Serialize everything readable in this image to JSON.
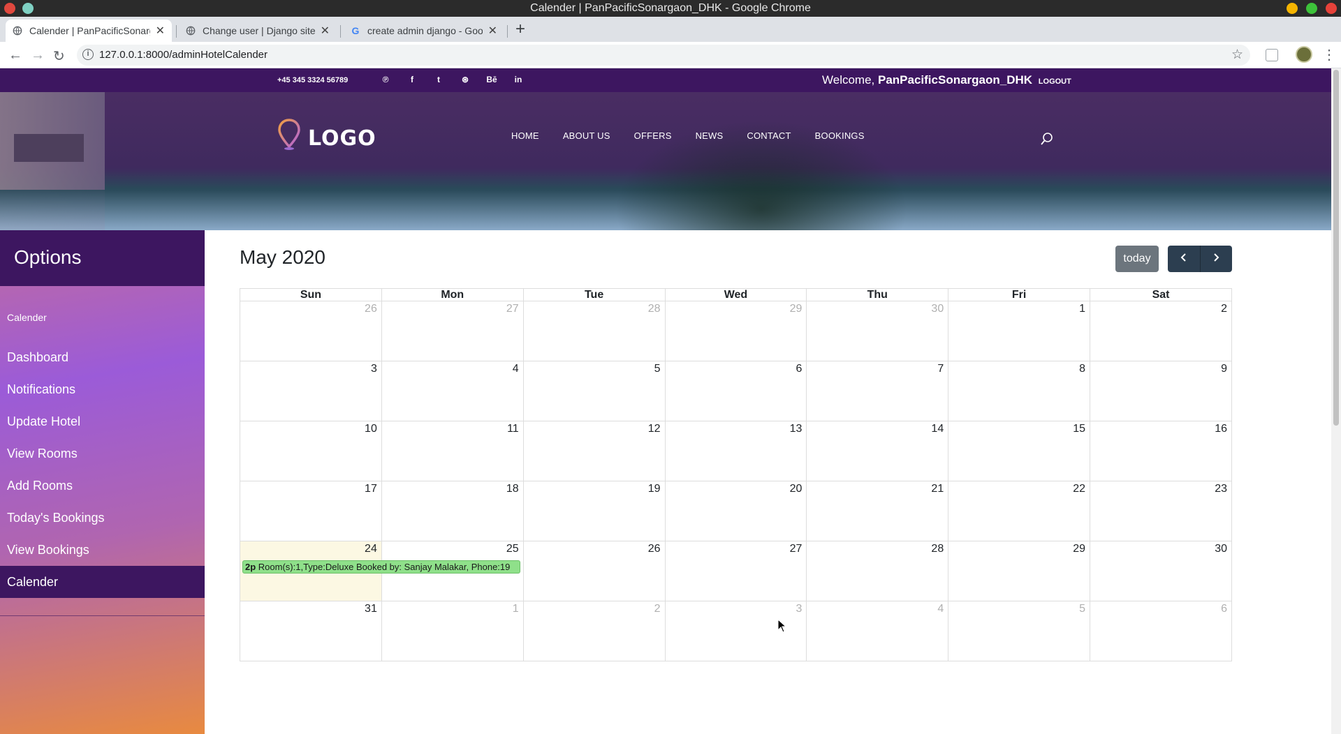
{
  "window": {
    "title": "Calender | PanPacificSonargaon_DHK - Google Chrome"
  },
  "browser": {
    "tabs": [
      {
        "label": "Calender | PanPacificSonarg",
        "active": true
      },
      {
        "label": "Change user | Django site ad",
        "active": false
      },
      {
        "label": "create admin django - Googl",
        "active": false
      }
    ],
    "new_tab": "+",
    "url": "127.0.0.1:8000/adminHotelCalender"
  },
  "topbar": {
    "phone": "+45 345 3324 56789",
    "socials": [
      "pinterest",
      "facebook",
      "twitter",
      "dribbble",
      "behance",
      "linkedin"
    ],
    "social_glyphs": [
      "℗",
      "f",
      "t",
      "⊛",
      "Bē",
      "in"
    ],
    "welcome_prefix": "Welcome,",
    "username": "PanPacificSonargaon_DHK",
    "logout": "LOGOUT"
  },
  "header": {
    "logo_text": "LOGO",
    "nav": [
      "HOME",
      "ABOUT US",
      "OFFERS",
      "NEWS",
      "CONTACT",
      "BOOKINGS"
    ]
  },
  "sidebar": {
    "title": "Options",
    "section": "Calender",
    "items": [
      {
        "label": "Dashboard"
      },
      {
        "label": "Notifications"
      },
      {
        "label": "Update Hotel"
      },
      {
        "label": "View Rooms"
      },
      {
        "label": "Add Rooms"
      },
      {
        "label": "Today's Bookings"
      },
      {
        "label": "View Bookings"
      },
      {
        "label": "Calender",
        "active": true
      }
    ]
  },
  "calendar": {
    "title": "May 2020",
    "today_label": "today",
    "prev": "‹",
    "next": "›",
    "weekdays": [
      "Sun",
      "Mon",
      "Tue",
      "Wed",
      "Thu",
      "Fri",
      "Sat"
    ],
    "weeks": [
      [
        "26",
        "27",
        "28",
        "29",
        "30",
        "1",
        "2"
      ],
      [
        "3",
        "4",
        "5",
        "6",
        "7",
        "8",
        "9"
      ],
      [
        "10",
        "11",
        "12",
        "13",
        "14",
        "15",
        "16"
      ],
      [
        "17",
        "18",
        "19",
        "20",
        "21",
        "22",
        "23"
      ],
      [
        "24",
        "25",
        "26",
        "27",
        "28",
        "29",
        "30"
      ],
      [
        "31",
        "1",
        "2",
        "3",
        "4",
        "5",
        "6"
      ]
    ],
    "event": {
      "time": "2p",
      "text": "Room(s):1,Type:Deluxe Booked by: Sanjay Malakar, Phone:19"
    }
  },
  "colors": {
    "brand_purple": "#3d1660",
    "today_bg": "#fcf8e3",
    "event_bg": "#8fe08a",
    "button_dark": "#2c3e50",
    "button_gray": "#6c757d"
  }
}
